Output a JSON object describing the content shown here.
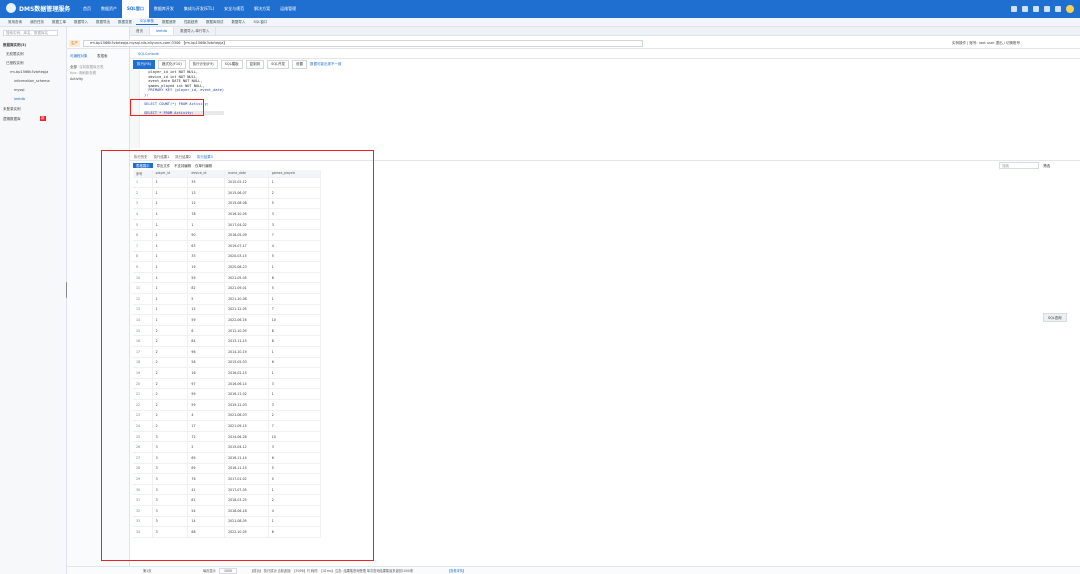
{
  "app": {
    "title": "DMS数据管理服务"
  },
  "topnav": [
    "首页",
    "数据资产",
    "SQL窗口",
    "数据库开发",
    "集成与开发(ETL)",
    "安全与规范",
    "解决方案",
    "运维管理"
  ],
  "subnav": [
    "常用查询",
    "我的任务",
    "数据工单",
    "数据导入",
    "数据导出",
    "数据变更",
    "SQL审核",
    "数据追踪",
    "性能趋势",
    "数据库测试",
    "数据导入",
    "SQL窗口"
  ],
  "left": {
    "search_placeholder": "搜索实例、库名、数据库名",
    "section_instances": "数据库实例(3)",
    "item1": "无权限实例",
    "item2": "已授权实例",
    "db_name": "rm-bp1566k3vbrtepja",
    "schema1": "information_schema",
    "schema2": "mysql",
    "schema3": "leetdb",
    "section_other": "未登录实例",
    "section_logical": "逻辑数据库",
    "logical_badge": "新"
  },
  "mid": {
    "tab1": "可编程对象",
    "tab2": "表搜索",
    "filter_label": "全部",
    "filter_hint": "当前数据库无表",
    "hint": "tips: 请刷新查看",
    "table": "Activity"
  },
  "tabs": [
    {
      "label": "首页"
    },
    {
      "label": "leetdb",
      "sub": "rm-bp1566k3vbrtepja"
    },
    {
      "label": "数据导入-单行导入"
    }
  ],
  "connection": {
    "env": "生产",
    "value": "rm-bp1566k3vbrtepja.mysql.rds.aliyuncs.com:3306 【rm-bp1566k3vbrtepja】",
    "right": "实例操作 | 账号: root user  退出 / 切换账号"
  },
  "sqltab": "SQLConsole",
  "toolbar": [
    "执行(F8)",
    "格式化(F10)",
    "执行计划(F9)",
    "SQL模板",
    "复制到",
    "SQL开发",
    "设置"
  ],
  "toolbar_tip": "数据可能出现不一致",
  "editor": {
    "lines": [
      "  player_id int NOT NULL,",
      "  device_id int NOT NULL,",
      "  event_date DATE NOT NULL,",
      "  games_played int NOT NULL,",
      "  PRIMARY KEY (player_id, event_date)",
      ");",
      "",
      "SELECT COUNT(*) FROM Activity;",
      "",
      "SELECT * FROM Activity;"
    ]
  },
  "results": {
    "tabs": [
      "执行历史",
      "执行结果1",
      "执行结果2",
      "执行结果3"
    ],
    "toolbar": [
      "表格展示",
      "导出文件",
      "不支持编辑",
      "仅单行编辑"
    ],
    "search_placeholder": "搜索",
    "filter_label": "筛选"
  },
  "table": {
    "columns": [
      "序号",
      "player_id",
      "device_id",
      "event_date",
      "games_played"
    ],
    "rows": [
      [
        "1",
        "1",
        "35",
        "2015-02-12",
        "1"
      ],
      [
        "2",
        "1",
        "13",
        "2015-06-07",
        "2"
      ],
      [
        "3",
        "1",
        "12",
        "2015-08-08",
        "5"
      ],
      [
        "4",
        "1",
        "78",
        "2016-10-05",
        "3"
      ],
      [
        "5",
        "1",
        "1",
        "2017-04-02",
        "3"
      ],
      [
        "6",
        "1",
        "90",
        "2018-05-09",
        "7"
      ],
      [
        "7",
        "1",
        "63",
        "2019-07-17",
        "4"
      ],
      [
        "8",
        "1",
        "33",
        "2020-03-15",
        "5"
      ],
      [
        "9",
        "1",
        "19",
        "2020-08-23",
        "1"
      ],
      [
        "10",
        "1",
        "59",
        "2021-05-05",
        "8"
      ],
      [
        "11",
        "1",
        "82",
        "2021-09-01",
        "5"
      ],
      [
        "12",
        "1",
        "5",
        "2021-10-08",
        "1"
      ],
      [
        "13",
        "1",
        "15",
        "2021-12-05",
        "7"
      ],
      [
        "14",
        "1",
        "59",
        "2022-06-16",
        "10"
      ],
      [
        "15",
        "2",
        "6",
        "2012-10-05",
        "8"
      ],
      [
        "16",
        "2",
        "84",
        "2013-11-15",
        "8"
      ],
      [
        "17",
        "2",
        "96",
        "2014-10-19",
        "1"
      ],
      [
        "18",
        "2",
        "58",
        "2015-05-03",
        "6"
      ],
      [
        "19",
        "2",
        "16",
        "2016-02-15",
        "1"
      ],
      [
        "20",
        "2",
        "97",
        "2016-06-14",
        "3"
      ],
      [
        "21",
        "2",
        "99",
        "2016-11-02",
        "1"
      ],
      [
        "22",
        "2",
        "59",
        "2019-12-03",
        "3"
      ],
      [
        "23",
        "2",
        "4",
        "2021-08-03",
        "2"
      ],
      [
        "24",
        "2",
        "17",
        "2021-09-15",
        "7"
      ],
      [
        "25",
        "3",
        "72",
        "2014-06-28",
        "10"
      ],
      [
        "26",
        "3",
        "2",
        "2015-04-12",
        "3"
      ],
      [
        "27",
        "3",
        "69",
        "2016-11-14",
        "6"
      ],
      [
        "28",
        "3",
        "69",
        "2016-11-15",
        "5"
      ],
      [
        "29",
        "3",
        "76",
        "2017-01-02",
        "0"
      ],
      [
        "30",
        "3",
        "41",
        "2017-07-05",
        "1"
      ],
      [
        "31",
        "3",
        "81",
        "2018-03-25",
        "2"
      ],
      [
        "32",
        "3",
        "54",
        "2018-06-18",
        "4"
      ],
      [
        "33",
        "3",
        "14",
        "2021-08-05",
        "1"
      ],
      [
        "34",
        "3",
        "68",
        "2022-10-05",
        "6"
      ]
    ]
  },
  "status": {
    "page_info": "第1页",
    "size_label": "每页显示",
    "size_value": "1000",
    "summary": "【成功】 执行成功  当前返回: 【3056】行  耗时: 【41ms】",
    "tip": "注意: 结果集查询受限  单次查询结果集最多返回1000条",
    "link": "【查看详情】"
  },
  "sql_helper": "SQL查询"
}
